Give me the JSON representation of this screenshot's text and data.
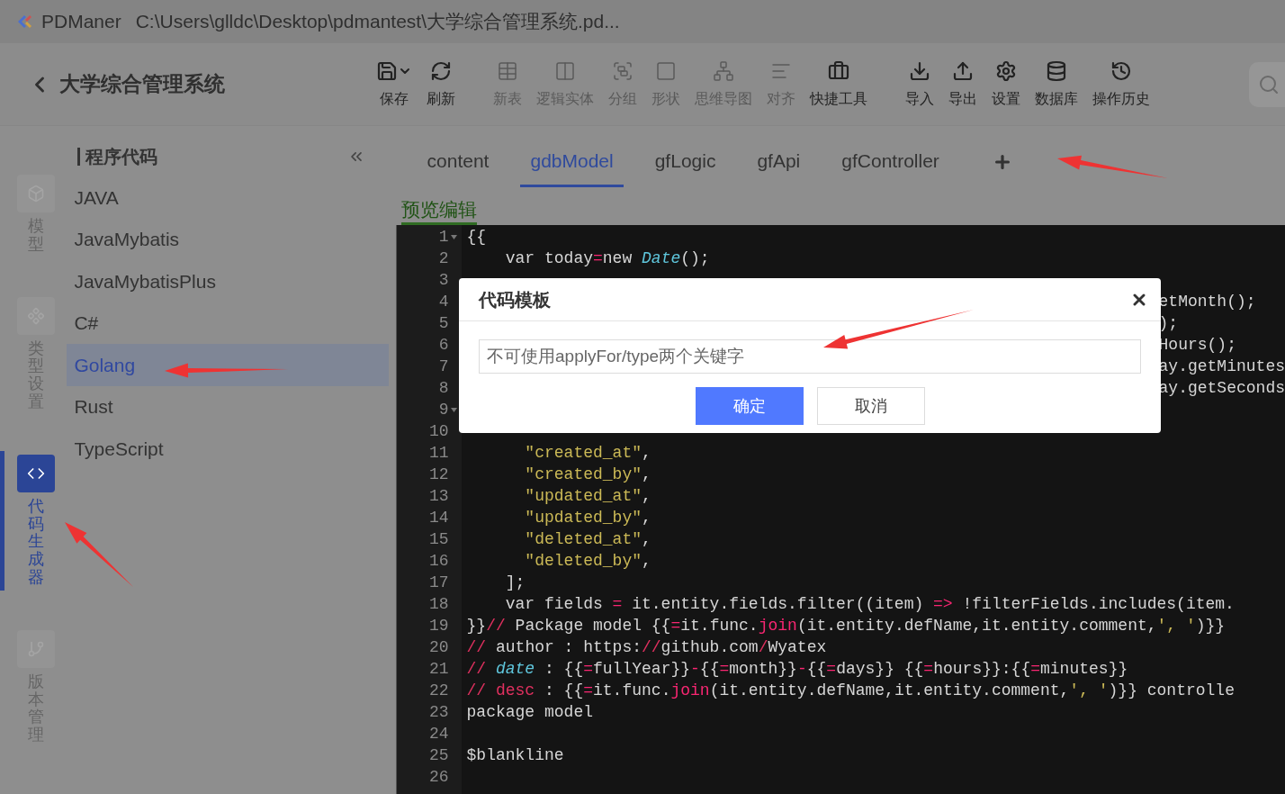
{
  "window": {
    "app": "PDManer",
    "path": "C:\\Users\\glldc\\Desktop\\pdmantest\\大学综合管理系统.pd..."
  },
  "header": {
    "project": "大学综合管理系统"
  },
  "toolbar": [
    {
      "label": "保存",
      "disabled": false,
      "dropdown": true
    },
    {
      "label": "刷新",
      "disabled": false,
      "dropdown": false
    },
    {
      "label": "新表",
      "disabled": true,
      "dropdown": false
    },
    {
      "label": "逻辑实体",
      "disabled": true,
      "dropdown": false
    },
    {
      "label": "分组",
      "disabled": true,
      "dropdown": false
    },
    {
      "label": "形状",
      "disabled": true,
      "dropdown": false
    },
    {
      "label": "思维导图",
      "disabled": true,
      "dropdown": false
    },
    {
      "label": "对齐",
      "disabled": true,
      "dropdown": false
    },
    {
      "label": "快捷工具",
      "disabled": false,
      "dropdown": false
    },
    {
      "label": "导入",
      "disabled": false,
      "dropdown": false
    },
    {
      "label": "导出",
      "disabled": false,
      "dropdown": false
    },
    {
      "label": "设置",
      "disabled": false,
      "dropdown": false
    },
    {
      "label": "数据库",
      "disabled": false,
      "dropdown": false
    },
    {
      "label": "操作历史",
      "disabled": false,
      "dropdown": false
    }
  ],
  "rail": [
    {
      "label": "模型",
      "selected": false
    },
    {
      "label": "类型设置",
      "selected": false
    },
    {
      "label": "代码生成器",
      "selected": true
    },
    {
      "label": "版本管理",
      "selected": false
    }
  ],
  "panel": {
    "title": "程序代码",
    "items": [
      {
        "label": "JAVA",
        "selected": false
      },
      {
        "label": "JavaMybatis",
        "selected": false
      },
      {
        "label": "JavaMybatisPlus",
        "selected": false
      },
      {
        "label": "C#",
        "selected": false
      },
      {
        "label": "Golang",
        "selected": true
      },
      {
        "label": "Rust",
        "selected": false
      },
      {
        "label": "TypeScript",
        "selected": false
      }
    ]
  },
  "tabs": [
    {
      "label": "content",
      "selected": false
    },
    {
      "label": "gdbModel",
      "selected": true
    },
    {
      "label": "gfLogic",
      "selected": false
    },
    {
      "label": "gfApi",
      "selected": false
    },
    {
      "label": "gfController",
      "selected": false
    }
  ],
  "subtabs": [
    {
      "label": "预览编辑",
      "selected": true
    }
  ],
  "code": {
    "lines": [
      {
        "number": "1",
        "fold": true,
        "kind": "code",
        "segments": [
          {
            "kind": "text",
            "text": "{{"
          }
        ]
      },
      {
        "number": "2",
        "fold": false,
        "kind": "code",
        "segments": [
          {
            "kind": "text",
            "text": "    var today"
          },
          {
            "kind": "op",
            "text": "="
          },
          {
            "kind": "text",
            "text": "new "
          },
          {
            "kind": "type",
            "text": "Date"
          },
          {
            "kind": "text",
            "text": "();"
          }
        ]
      },
      {
        "number": "3",
        "fold": false,
        "kind": "code"
      },
      {
        "number": "4",
        "fold": false,
        "kind": "tail",
        "segments": [
          {
            "kind": "text",
            "text": "etMonth();"
          }
        ]
      },
      {
        "number": "5",
        "fold": false,
        "kind": "tail",
        "segments": [
          {
            "kind": "text",
            "text": ");"
          }
        ]
      },
      {
        "number": "6",
        "fold": false,
        "kind": "tail",
        "segments": [
          {
            "kind": "text",
            "text": "Hours();"
          }
        ]
      },
      {
        "number": "7",
        "fold": false,
        "kind": "tail",
        "segments": [
          {
            "kind": "text",
            "text": "ay.getMinutes"
          }
        ]
      },
      {
        "number": "8",
        "fold": false,
        "kind": "tail",
        "segments": [
          {
            "kind": "text",
            "text": "ay.getSeconds"
          }
        ]
      },
      {
        "number": "9",
        "fold": true,
        "kind": "code"
      },
      {
        "number": "10",
        "fold": false,
        "kind": "code"
      },
      {
        "number": "11",
        "fold": false,
        "kind": "code",
        "segments": [
          {
            "kind": "str",
            "text": "      \"created_at\""
          },
          {
            "kind": "text",
            "text": ","
          }
        ]
      },
      {
        "number": "12",
        "fold": false,
        "kind": "code",
        "segments": [
          {
            "kind": "str",
            "text": "      \"created_by\""
          },
          {
            "kind": "text",
            "text": ","
          }
        ]
      },
      {
        "number": "13",
        "fold": false,
        "kind": "code",
        "segments": [
          {
            "kind": "str",
            "text": "      \"updated_at\""
          },
          {
            "kind": "text",
            "text": ","
          }
        ]
      },
      {
        "number": "14",
        "fold": false,
        "kind": "code",
        "segments": [
          {
            "kind": "str",
            "text": "      \"updated_by\""
          },
          {
            "kind": "text",
            "text": ","
          }
        ]
      },
      {
        "number": "15",
        "fold": false,
        "kind": "code",
        "segments": [
          {
            "kind": "str",
            "text": "      \"deleted_at\""
          },
          {
            "kind": "text",
            "text": ","
          }
        ]
      },
      {
        "number": "16",
        "fold": false,
        "kind": "code",
        "segments": [
          {
            "kind": "str",
            "text": "      \"deleted_by\""
          },
          {
            "kind": "text",
            "text": ","
          }
        ]
      },
      {
        "number": "17",
        "fold": false,
        "kind": "code",
        "segments": [
          {
            "kind": "text",
            "text": "    ];"
          }
        ]
      },
      {
        "number": "18",
        "fold": false,
        "kind": "code",
        "segments": [
          {
            "kind": "text",
            "text": "    var fields "
          },
          {
            "kind": "op",
            "text": "="
          },
          {
            "kind": "text",
            "text": " it.entity.fields.filter((item) "
          },
          {
            "kind": "op",
            "text": "=>"
          },
          {
            "kind": "text",
            "text": " !filterFields.includes(item."
          }
        ]
      },
      {
        "number": "19",
        "fold": false,
        "kind": "code",
        "segments": [
          {
            "kind": "text",
            "text": "}}"
          },
          {
            "kind": "comment",
            "text": "//"
          },
          {
            "kind": "text",
            "text": " Package model {{"
          },
          {
            "kind": "op",
            "text": "="
          },
          {
            "kind": "text",
            "text": "it.func."
          },
          {
            "kind": "op",
            "text": "join"
          },
          {
            "kind": "text",
            "text": "(it.entity.defName,it.entity.comment,"
          },
          {
            "kind": "str",
            "text": "', '"
          },
          {
            "kind": "text",
            "text": ")}}"
          }
        ]
      },
      {
        "number": "20",
        "fold": false,
        "kind": "code",
        "segments": [
          {
            "kind": "comment",
            "text": "//"
          },
          {
            "kind": "text",
            "text": " author : https:"
          },
          {
            "kind": "comment",
            "text": "//"
          },
          {
            "kind": "text",
            "text": "github.com"
          },
          {
            "kind": "comment",
            "text": "/"
          },
          {
            "kind": "text",
            "text": "Wyatex"
          }
        ]
      },
      {
        "number": "21",
        "fold": false,
        "kind": "code",
        "segments": [
          {
            "kind": "comment",
            "text": "// "
          },
          {
            "kind": "type",
            "text": "date"
          },
          {
            "kind": "text",
            "text": " : {{"
          },
          {
            "kind": "op",
            "text": "="
          },
          {
            "kind": "text",
            "text": "fullYear}}"
          },
          {
            "kind": "op",
            "text": "-"
          },
          {
            "kind": "text",
            "text": "{{"
          },
          {
            "kind": "op",
            "text": "="
          },
          {
            "kind": "text",
            "text": "month}}"
          },
          {
            "kind": "op",
            "text": "-"
          },
          {
            "kind": "text",
            "text": "{{"
          },
          {
            "kind": "op",
            "text": "="
          },
          {
            "kind": "text",
            "text": "days}} {{"
          },
          {
            "kind": "op",
            "text": "="
          },
          {
            "kind": "text",
            "text": "hours}}:{{"
          },
          {
            "kind": "op",
            "text": "="
          },
          {
            "kind": "text",
            "text": "minutes}}"
          }
        ]
      },
      {
        "number": "22",
        "fold": false,
        "kind": "code",
        "segments": [
          {
            "kind": "comment",
            "text": "// desc"
          },
          {
            "kind": "text",
            "text": " : {{"
          },
          {
            "kind": "op",
            "text": "="
          },
          {
            "kind": "text",
            "text": "it.func."
          },
          {
            "kind": "op",
            "text": "join"
          },
          {
            "kind": "text",
            "text": "(it.entity.defName,it.entity.comment,"
          },
          {
            "kind": "str",
            "text": "', '"
          },
          {
            "kind": "text",
            "text": ")}} controlle"
          }
        ]
      },
      {
        "number": "23",
        "fold": false,
        "kind": "code",
        "segments": [
          {
            "kind": "text",
            "text": "package model"
          }
        ]
      },
      {
        "number": "24",
        "fold": false,
        "kind": "code"
      },
      {
        "number": "25",
        "fold": false,
        "kind": "code",
        "segments": [
          {
            "kind": "text",
            "text": "$blankline"
          }
        ]
      },
      {
        "number": "26",
        "fold": false,
        "kind": "code"
      }
    ]
  },
  "dialog": {
    "title": "代码模板",
    "placeholder": "不可使用applyFor/type两个关键字",
    "buttons": [
      {
        "label": "确定",
        "kind": "primary"
      },
      {
        "label": "取消",
        "kind": "default"
      }
    ]
  }
}
